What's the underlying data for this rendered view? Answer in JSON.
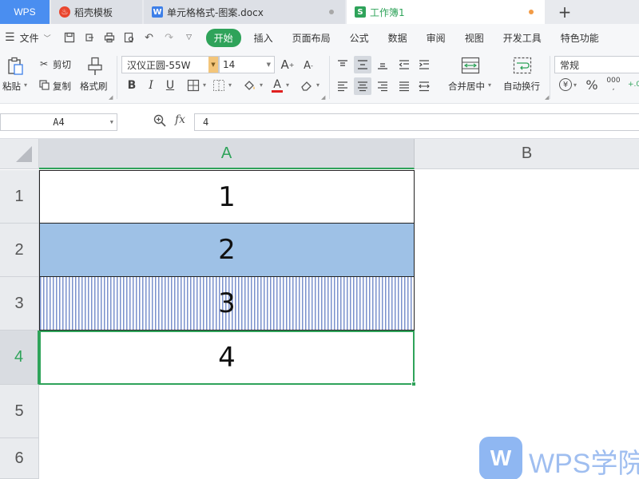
{
  "tabs": {
    "brand": "WPS",
    "items": [
      {
        "label": "稻壳模板",
        "icon": "daoke-flame-icon"
      },
      {
        "label": "单元格格式-图案.docx",
        "icon": "word-doc-icon"
      },
      {
        "label": "工作簿1",
        "icon": "spreadsheet-icon"
      }
    ],
    "new_tab": "+"
  },
  "menubar": {
    "file": "文件",
    "items": [
      "开始",
      "插入",
      "页面布局",
      "公式",
      "数据",
      "审阅",
      "视图",
      "开发工具",
      "特色功能"
    ],
    "active": "开始"
  },
  "ribbon": {
    "paste": "粘贴",
    "cut": "剪切",
    "copy": "复制",
    "format_painter": "格式刷",
    "font_name": "汉仪正圆-55W",
    "font_size": "14",
    "bold": "B",
    "italic": "I",
    "underline": "U",
    "font_color": "A",
    "merge_center": "合并居中",
    "wrap_text": "自动换行",
    "number_format": "常规",
    "percent": "%"
  },
  "formula_bar": {
    "name_box": "A4",
    "fx": "fx",
    "value": "4"
  },
  "sheet": {
    "columns": [
      "A",
      "B"
    ],
    "rows": [
      "1",
      "2",
      "3",
      "4",
      "5",
      "6"
    ],
    "cells": [
      "1",
      "2",
      "3",
      "4"
    ],
    "selected_cell": "A4"
  },
  "colors": {
    "accent": "#2fa35a",
    "row2_fill": "#9ec1e6",
    "row3_pattern": "#7a91cc"
  },
  "watermark": {
    "logo": "W",
    "text": "WPS学院"
  }
}
